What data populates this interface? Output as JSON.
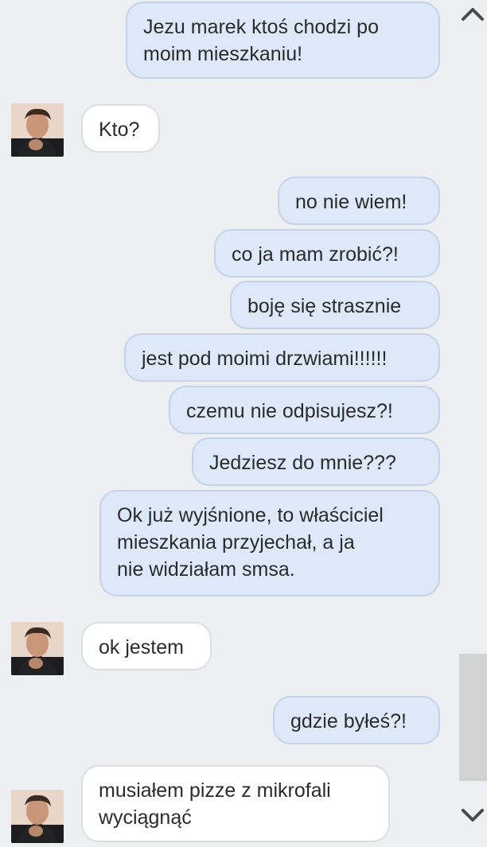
{
  "messages": [
    {
      "side": "out",
      "text": "Jezu marek ktoś chodzi po\nmoim mieszkaniu!"
    },
    {
      "side": "in",
      "text": "Kto?"
    },
    {
      "side": "out",
      "text": "no nie wiem!"
    },
    {
      "side": "out",
      "text": "co ja mam zrobić?!"
    },
    {
      "side": "out",
      "text": "boję się strasznie"
    },
    {
      "side": "out",
      "text": "jest pod moimi drzwiami!!!!!!"
    },
    {
      "side": "out",
      "text": "czemu nie odpisujesz?!"
    },
    {
      "side": "out",
      "text": "Jedziesz do mnie???"
    },
    {
      "side": "out",
      "text": "Ok już wyjśnione, to właściciel\nmieszkania przyjechał, a ja\nnie widziałam smsa."
    },
    {
      "side": "in",
      "text": "ok jestem"
    },
    {
      "side": "out",
      "text": "gdzie byłeś?!"
    },
    {
      "side": "in",
      "text": "musiałem pizze z mikrofali\nwyciągnąć"
    }
  ],
  "icons": {
    "scroll_up": "chevron-up-icon",
    "scroll_down": "chevron-down-icon",
    "avatar": "contact-avatar"
  },
  "colors": {
    "outgoing_bubble": "#dde9f9",
    "incoming_bubble": "#ffffff",
    "background": "#eeeff2"
  }
}
